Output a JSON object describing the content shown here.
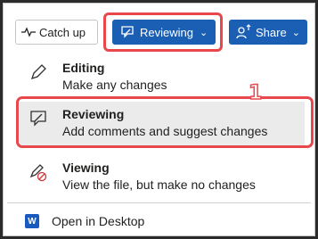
{
  "toolbar": {
    "catchup_label": "Catch up",
    "reviewing_label": "Reviewing",
    "share_label": "Share"
  },
  "menu": {
    "items": [
      {
        "title": "Editing",
        "desc": "Make any changes",
        "icon": "pencil-icon"
      },
      {
        "title": "Reviewing",
        "desc": "Add comments and suggest changes",
        "icon": "review-icon"
      },
      {
        "title": "Viewing",
        "desc": "View the file, but make no changes",
        "icon": "pencil-no-icon"
      }
    ],
    "open_desktop_label": "Open in Desktop"
  },
  "annotation": {
    "number": "1"
  },
  "colors": {
    "accent": "#1a5fb4",
    "highlight": "#e8474c",
    "selected_bg": "#ebebeb"
  }
}
